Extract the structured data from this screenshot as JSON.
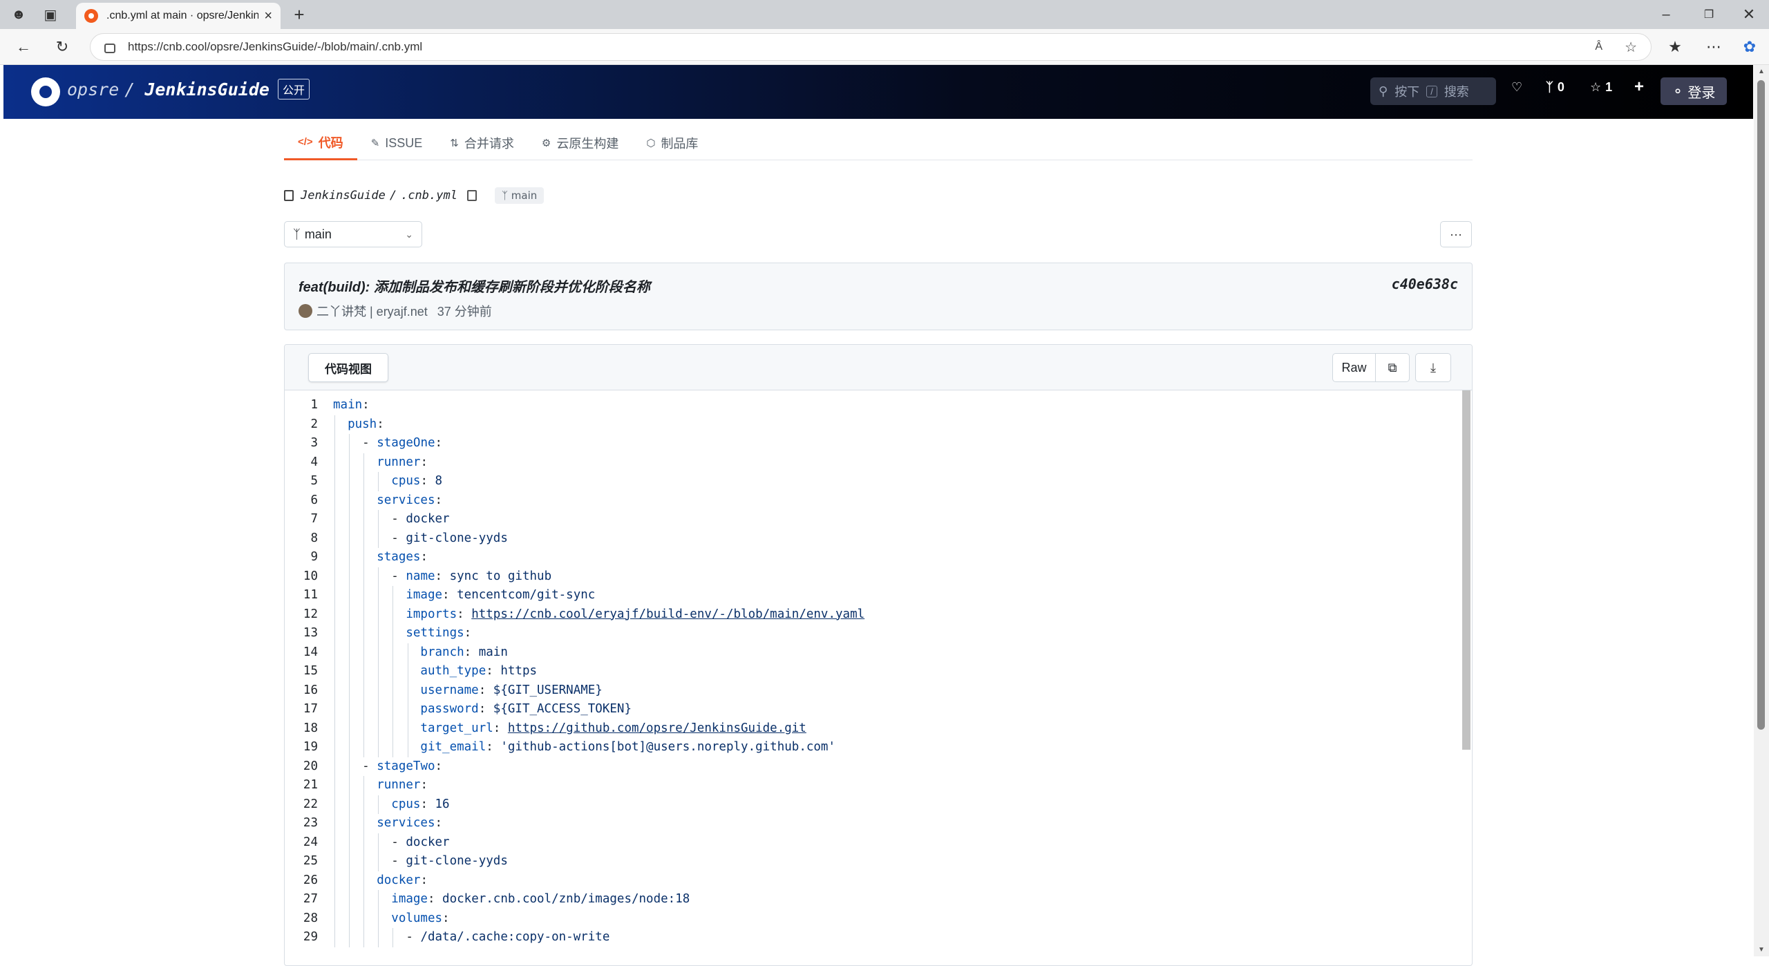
{
  "browser": {
    "tab_title": ".cnb.yml at main · opsre/JenkinsG",
    "url": "https://cnb.cool/opsre/JenkinsGuide/-/blob/main/.cnb.yml"
  },
  "header": {
    "org": "opsre",
    "sep": "/",
    "repo": "JenkinsGuide",
    "visibility": "公开",
    "search_placeholder": "按下",
    "search_key": "/",
    "search_label": "搜索",
    "forks": "0",
    "stars": "1",
    "login": "登录"
  },
  "tabs": [
    {
      "label": "代码",
      "icon": "code-icon"
    },
    {
      "label": "ISSUE",
      "icon": "issue-icon"
    },
    {
      "label": "合并请求",
      "icon": "merge-icon"
    },
    {
      "label": "云原生构建",
      "icon": "build-icon"
    },
    {
      "label": "制品库",
      "icon": "package-icon"
    }
  ],
  "breadcrumb": {
    "repo": "JenkinsGuide",
    "sep": "/",
    "file": ".cnb.yml",
    "branch": "main"
  },
  "branch_select": "main",
  "more_label": "···",
  "commit": {
    "message": "feat(build): 添加制品发布和缓存刷新阶段并优化阶段名称",
    "hash": "c40e638c",
    "author": "二丫讲梵 | eryajf.net",
    "time": "37 分钟前"
  },
  "file_view": {
    "tab": "代码视图",
    "raw": "Raw"
  },
  "code_lines": [
    "main:",
    "  push:",
    "    - stageOne:",
    "      runner:",
    "        cpus: 8",
    "      services:",
    "        - docker",
    "        - git-clone-yyds",
    "      stages:",
    "        - name: sync to github",
    "          image: tencentcom/git-sync",
    "          imports: https://cnb.cool/eryajf/build-env/-/blob/main/env.yaml",
    "          settings:",
    "            branch: main",
    "            auth_type: https",
    "            username: ${GIT_USERNAME}",
    "            password: ${GIT_ACCESS_TOKEN}",
    "            target_url: https://github.com/opsre/JenkinsGuide.git",
    "            git_email: 'github-actions[bot]@users.noreply.github.com'",
    "    - stageTwo:",
    "      runner:",
    "        cpus: 16",
    "      services:",
    "        - docker",
    "        - git-clone-yyds",
    "      docker:",
    "        image: docker.cnb.cool/znb/images/node:18",
    "        volumes:",
    "          - /data/.cache:copy-on-write"
  ],
  "colors": {
    "accent": "#f05a28",
    "yaml_key": "#0550ae",
    "yaml_value": "#0a3069"
  }
}
